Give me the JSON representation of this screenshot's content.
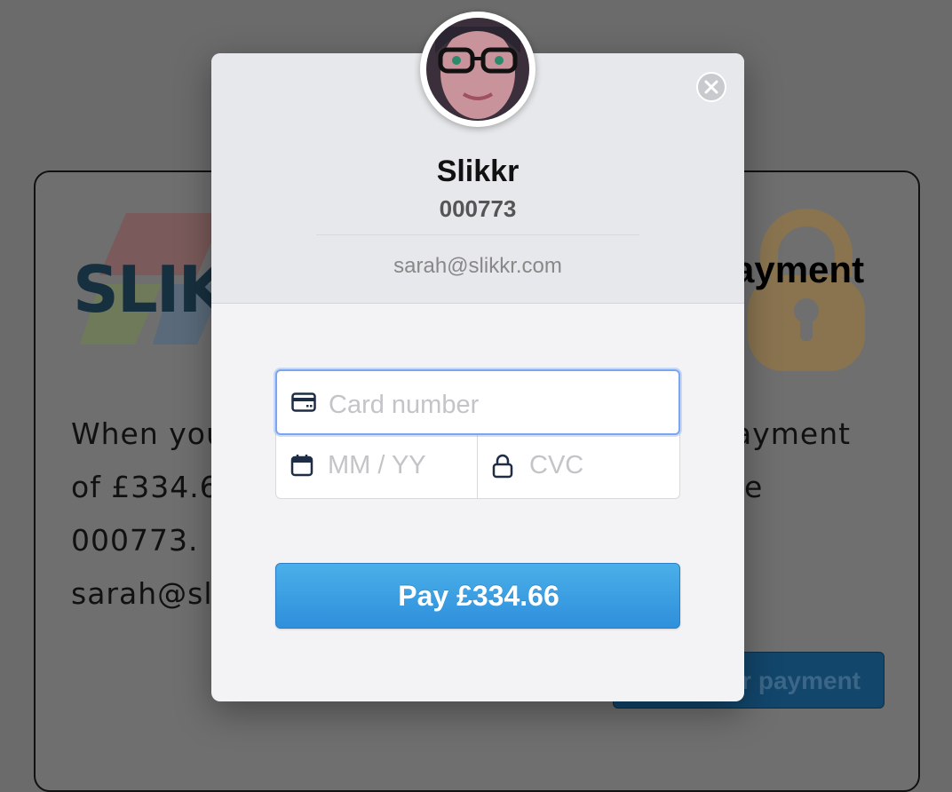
{
  "background_page": {
    "logo_text": "SLIK",
    "heading": "ayment",
    "para_left": [
      "When you",
      "of £334.6",
      "000773.",
      "sarah@sl"
    ],
    "para_right": [
      "ayment",
      "e"
    ],
    "button_label": "r payment"
  },
  "modal": {
    "merchant_name": "Slikkr",
    "reference": "000773",
    "email": "sarah@slikkr.com",
    "card_number_placeholder": "Card number",
    "expiry_placeholder": "MM / YY",
    "cvc_placeholder": "CVC",
    "pay_button_label": "Pay £334.66"
  },
  "colors": {
    "overlay": "#6b6b6b",
    "pay_button": "#3a9fe4",
    "focus_border": "#7aa6f0"
  }
}
